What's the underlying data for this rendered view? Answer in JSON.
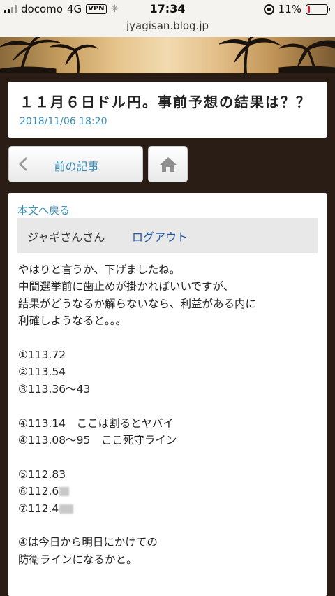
{
  "status_bar": {
    "carrier": "docomo",
    "network": "4G",
    "vpn_label": "VPN",
    "time": "17:34",
    "battery_percent": "11%",
    "battery_level": 0.11
  },
  "browser": {
    "url": "jyagisan.blog.jp"
  },
  "article": {
    "title": "１１月６日ドル円。事前予想の結果は？？",
    "date": "2018/11/06 18:20"
  },
  "nav": {
    "prev_label": "前の記事",
    "icons": {
      "prev": "chevron-left-icon",
      "home": "home-icon"
    }
  },
  "content": {
    "back_link": "本文へ戻る",
    "user_name": "ジャギさんさん",
    "logout": "ログアウト",
    "lines": [
      "やはりと言うか、下げましたね。",
      "中間選挙前に歯止めが掛かればいいですが、",
      "結果がどうなるか解らないなら、利益がある内に",
      "利確しようなると。。。",
      "",
      "①113.72",
      "②113.54",
      "③113.36～43",
      "",
      "④113.14　ここは割るとヤバイ",
      "④113.08～95　ここ死守ライン",
      "",
      "⑤112.83",
      "⑥112.6",
      "⑦112.4",
      "",
      "④は今日から明日にかけての",
      "防衛ラインになるかと。"
    ]
  },
  "colors": {
    "accent": "#3a8fb7",
    "logout": "#1f5aa8",
    "background": "#2a1d15",
    "battery_low": "#e0182b"
  }
}
